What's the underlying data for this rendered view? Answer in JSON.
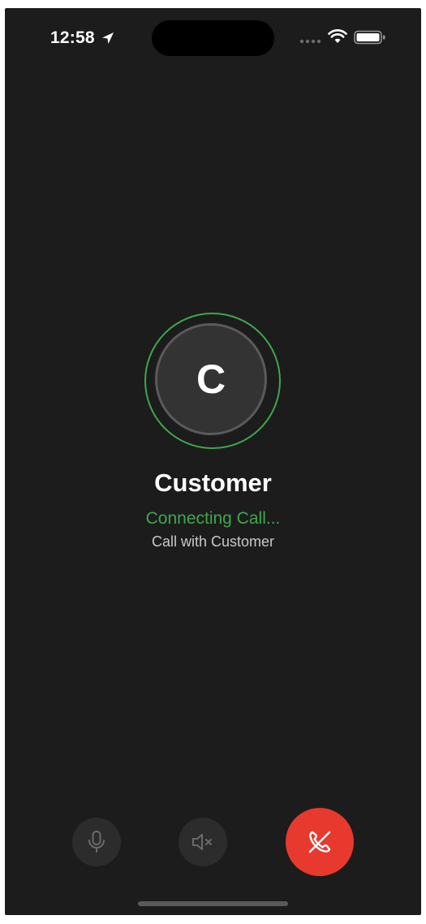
{
  "status_bar": {
    "time": "12:58",
    "location_icon": "location-arrow-icon",
    "signal_icon": "cellular-signal-icon",
    "wifi_icon": "wifi-icon",
    "battery_icon": "battery-icon"
  },
  "caller": {
    "initial": "C",
    "name": "Customer",
    "status": "Connecting Call...",
    "subtitle": "Call with Customer"
  },
  "controls": {
    "mute_icon": "microphone-icon",
    "speaker_icon": "speaker-muted-icon",
    "end_call_icon": "phone-hangup-icon"
  },
  "colors": {
    "background": "#1c1c1c",
    "accent_green": "#3ea84a",
    "end_call_red": "#e8392e",
    "control_gray": "#2c2c2c"
  }
}
